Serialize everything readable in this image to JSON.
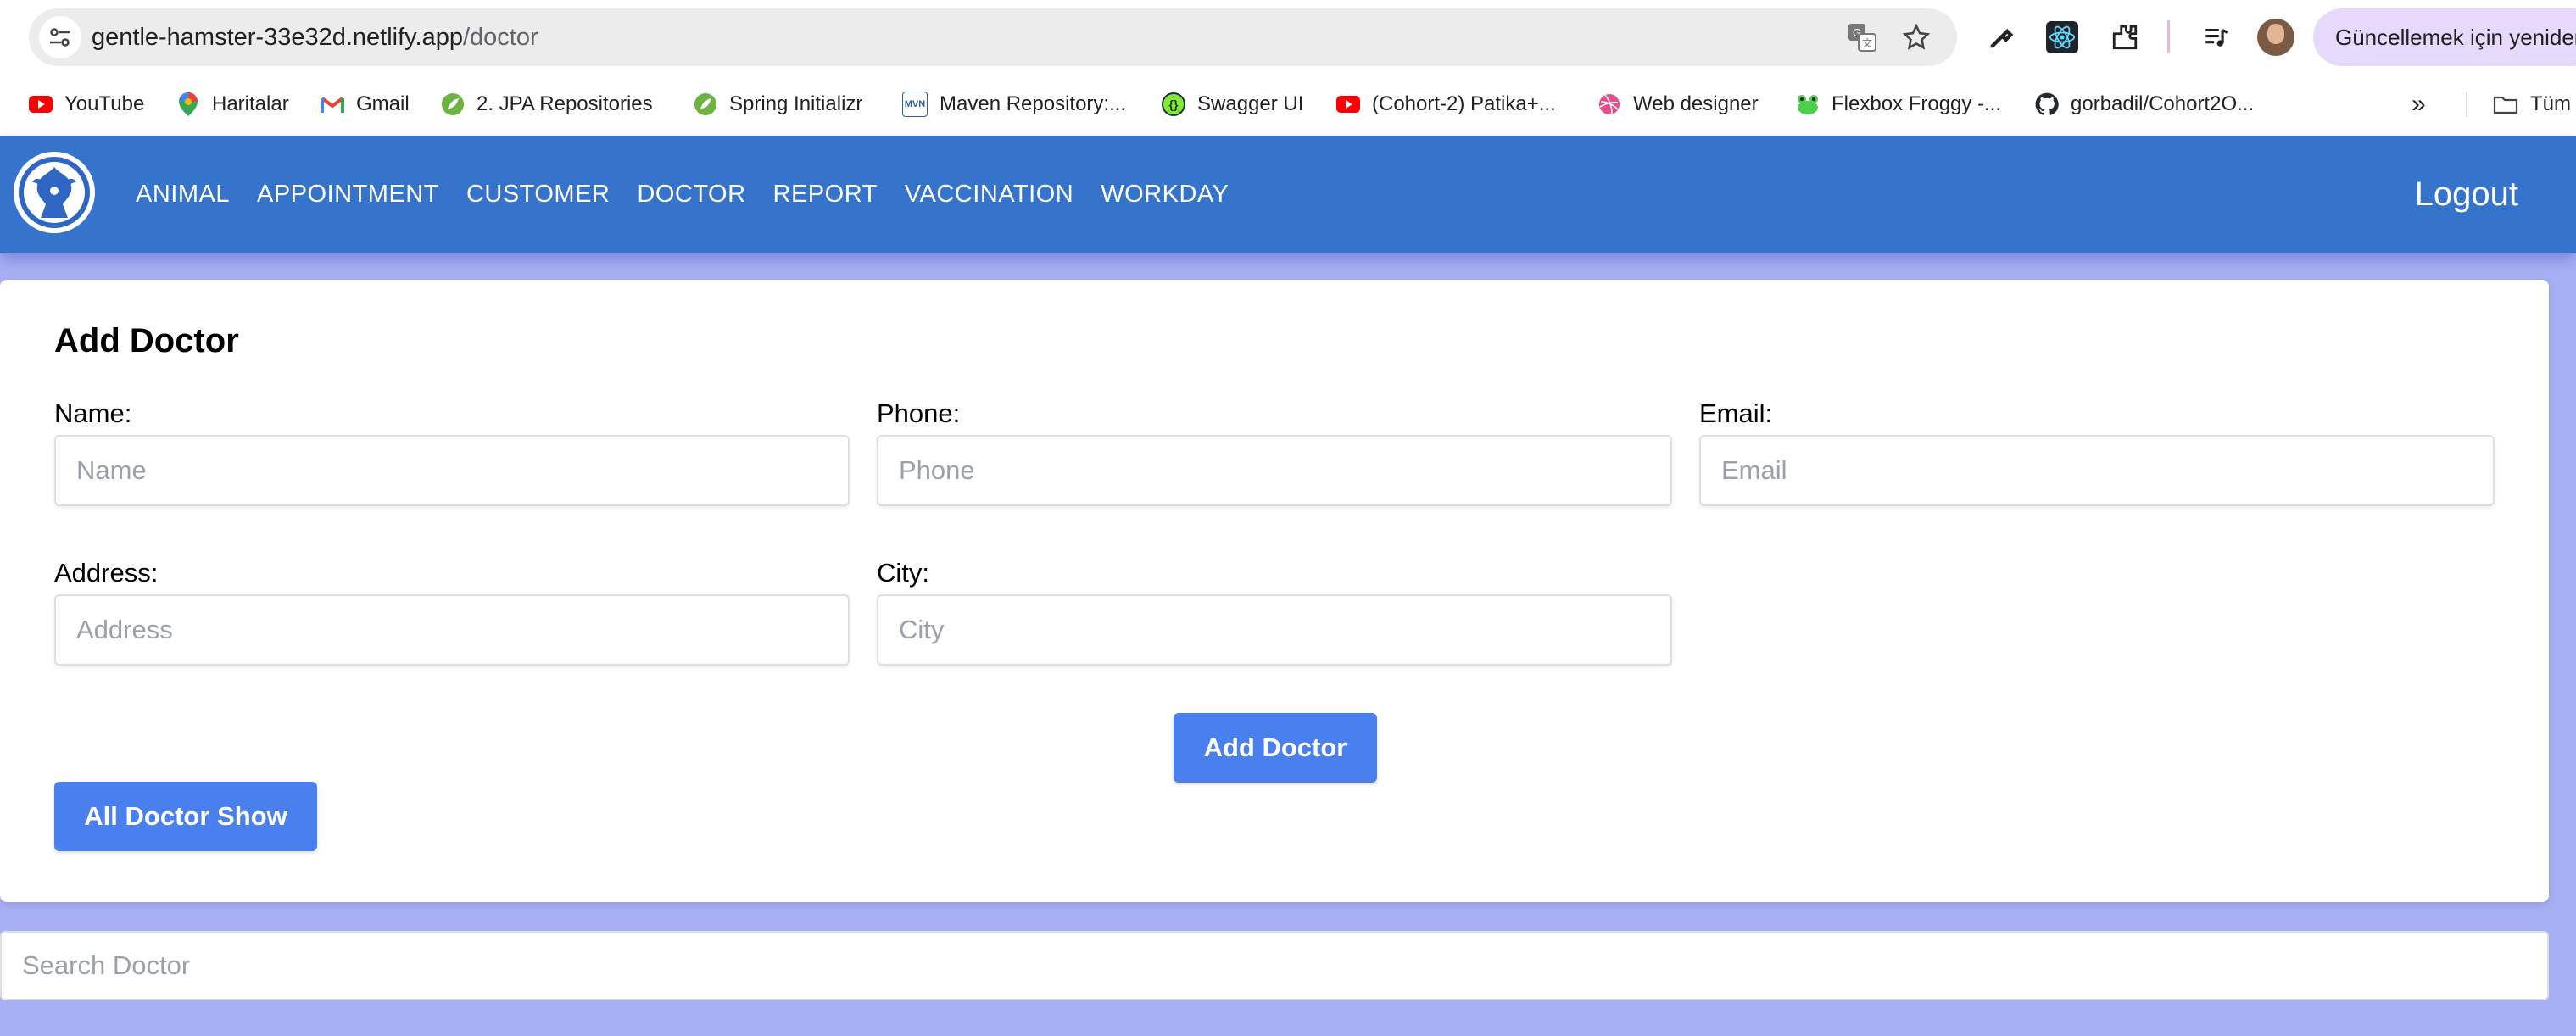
{
  "browser": {
    "url_host": "gentle-hamster-33e32d.netlify.app",
    "url_path": "/doctor",
    "update_button": "Güncellemek için yeniden başlatın",
    "bookmarks": [
      {
        "label": "YouTube",
        "icon": "youtube-icon",
        "color": "#ff0000"
      },
      {
        "label": "Haritalar",
        "icon": "maps-icon",
        "color": "#34a853"
      },
      {
        "label": "Gmail",
        "icon": "gmail-icon",
        "color": "#ea4335"
      },
      {
        "label": "2. JPA Repositories",
        "icon": "spring-icon",
        "color": "#6db33f"
      },
      {
        "label": "Spring Initializr",
        "icon": "spring-icon",
        "color": "#6db33f"
      },
      {
        "label": "Maven Repository:...",
        "icon": "maven-icon",
        "color": "#2a5caa"
      },
      {
        "label": "Swagger UI",
        "icon": "swagger-icon",
        "color": "#85ea2d"
      },
      {
        "label": "(Cohort-2) Patika+...",
        "icon": "youtube-icon",
        "color": "#ff0000"
      },
      {
        "label": "Web designer",
        "icon": "dribbble-icon",
        "color": "#ea4c89"
      },
      {
        "label": "Flexbox Froggy -...",
        "icon": "frog-icon",
        "color": "#4cd04c"
      },
      {
        "label": "gorbadil/Cohort2O...",
        "icon": "github-icon",
        "color": "#24292e"
      }
    ],
    "all_bookmarks_label": "Tüm Yer İşaretleri"
  },
  "nav": {
    "links": [
      "ANIMAL",
      "APPOINTMENT",
      "CUSTOMER",
      "DOCTOR",
      "REPORT",
      "VACCINATION",
      "WORKDAY"
    ],
    "logout": "Logout"
  },
  "form": {
    "title": "Add Doctor",
    "name_label": "Name:",
    "name_placeholder": "Name",
    "phone_label": "Phone:",
    "phone_placeholder": "Phone",
    "email_label": "Email:",
    "email_placeholder": "Email",
    "address_label": "Address:",
    "address_placeholder": "Address",
    "city_label": "City:",
    "city_placeholder": "City",
    "submit_label": "Add Doctor",
    "show_all_label": "All Doctor Show"
  },
  "search": {
    "placeholder": "Search Doctor"
  },
  "colors": {
    "navbar": "#3674cc",
    "button": "#4a80ee",
    "page_bg": "#a8b0f5"
  }
}
